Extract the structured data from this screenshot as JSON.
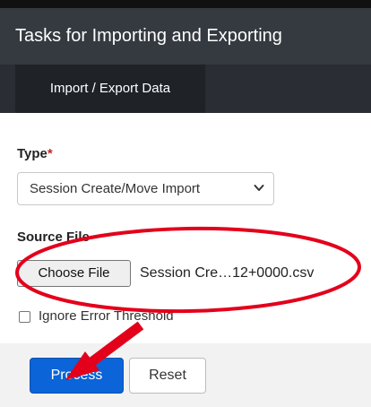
{
  "header": {
    "title": "Tasks for Importing and Exporting"
  },
  "tabs": [
    {
      "label": "Import / Export Data"
    }
  ],
  "form": {
    "type_label": "Type",
    "required_marker": "*",
    "type_value": "Session Create/Move Import",
    "source_file_label": "Source File",
    "choose_file_label": "Choose File",
    "file_name": "Session Cre…12+0000.csv",
    "ignore_error_label": "Ignore Error Threshold",
    "ignore_error_checked": false
  },
  "actions": {
    "process_label": "Process",
    "reset_label": "Reset"
  },
  "annotations": {
    "highlight_color": "#e3001b",
    "arrow_color": "#e3001b"
  },
  "colors": {
    "primary": "#0b64d8",
    "header_bg": "#353a41"
  }
}
